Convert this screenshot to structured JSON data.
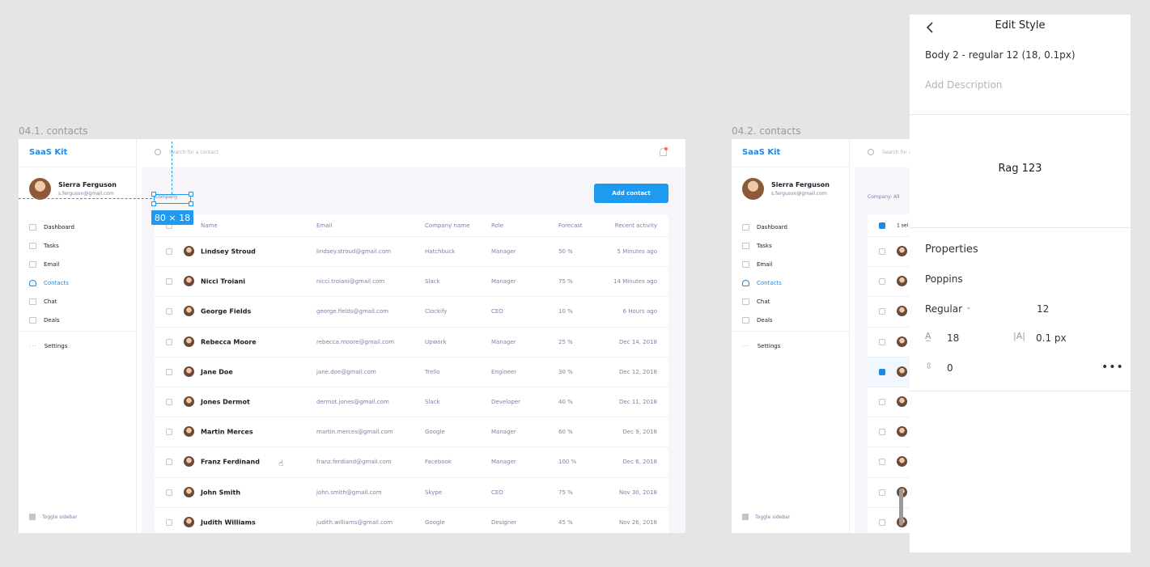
{
  "frames": [
    {
      "label": "04.1. contacts"
    },
    {
      "label": "04.2. contacts"
    }
  ],
  "app": {
    "brand": "SaaS Kit",
    "user": {
      "name": "Sierra Ferguson",
      "email": "s.ferguson@gmail.com"
    },
    "nav": [
      {
        "label": "Dashboard",
        "icon": "grid-icon"
      },
      {
        "label": "Tasks",
        "icon": "tasks-icon"
      },
      {
        "label": "Email",
        "icon": "mail-icon"
      },
      {
        "label": "Contacts",
        "icon": "user-icon",
        "active": true
      },
      {
        "label": "Chat",
        "icon": "chat-icon"
      },
      {
        "label": "Deals",
        "icon": "deals-icon"
      }
    ],
    "settings_label": "Settings",
    "toggle_sidebar": "Toggle sidebar",
    "search_placeholder": "Search for a contact",
    "add_contact": "Add contact",
    "company_filter": "Company",
    "company_filter_2": "Company: All",
    "selected_count": "1 sel",
    "columns": [
      "Name",
      "Email",
      "Company name",
      "Role",
      "Forecast",
      "Recent activity"
    ],
    "rows": [
      {
        "name": "Lindsey Stroud",
        "email": "lindsey.stroud@gmail.com",
        "company": "Hatchbuck",
        "role": "Manager",
        "forecast": "50 %",
        "activity": "5 Minutes ago"
      },
      {
        "name": "Nicci Troiani",
        "email": "nicci.troiani@gmail.com",
        "company": "Slack",
        "role": "Manager",
        "forecast": "75 %",
        "activity": "14 Minutes ago"
      },
      {
        "name": "George Fields",
        "email": "george.fields@gmail.com",
        "company": "Clockify",
        "role": "CEO",
        "forecast": "10 %",
        "activity": "6 Hours ago"
      },
      {
        "name": "Rebecca Moore",
        "email": "rebecca.moore@gmail.com",
        "company": "Upwork",
        "role": "Manager",
        "forecast": "25 %",
        "activity": "Dec 14, 2018"
      },
      {
        "name": "Jane Doe",
        "email": "jane.doe@gmail.com",
        "company": "Trello",
        "role": "Engineer",
        "forecast": "30 %",
        "activity": "Dec 12, 2018"
      },
      {
        "name": "Jones Dermot",
        "email": "dermot.jones@gmail.com",
        "company": "Slack",
        "role": "Developer",
        "forecast": "40 %",
        "activity": "Dec 11, 2018"
      },
      {
        "name": "Martin Merces",
        "email": "martin.merces@gmail.com",
        "company": "Google",
        "role": "Manager",
        "forecast": "60 %",
        "activity": "Dec 9, 2018"
      },
      {
        "name": "Franz Ferdinand",
        "email": "franz.ferdiand@gmail.com",
        "company": "Facebook",
        "role": "Manager",
        "forecast": "100 %",
        "activity": "Dec 6, 2018"
      },
      {
        "name": "John Smith",
        "email": "john.smith@gmail.com",
        "company": "Skype",
        "role": "CEO",
        "forecast": "75 %",
        "activity": "Nov 30, 2018"
      },
      {
        "name": "Judith Williams",
        "email": "judith.williams@gmail.com",
        "company": "Google",
        "role": "Designer",
        "forecast": "45 %",
        "activity": "Nov 26, 2018"
      }
    ]
  },
  "measure": {
    "dimensions": "80 × 18"
  },
  "panel": {
    "title": "Edit Style",
    "style_name": "Body 2 - regular 12 (18, 0.1px)",
    "description_placeholder": "Add Description",
    "preview": "Rag 123",
    "properties_label": "Properties",
    "font_family": "Poppins",
    "font_weight": "Regular",
    "font_size": "12",
    "line_height": "18",
    "letter_spacing": "0.1 px",
    "paragraph_spacing": "0"
  },
  "colors": {
    "accent": "#1e9bf0",
    "brand": "#1e88e5",
    "canvas": "#e5e5e5"
  }
}
